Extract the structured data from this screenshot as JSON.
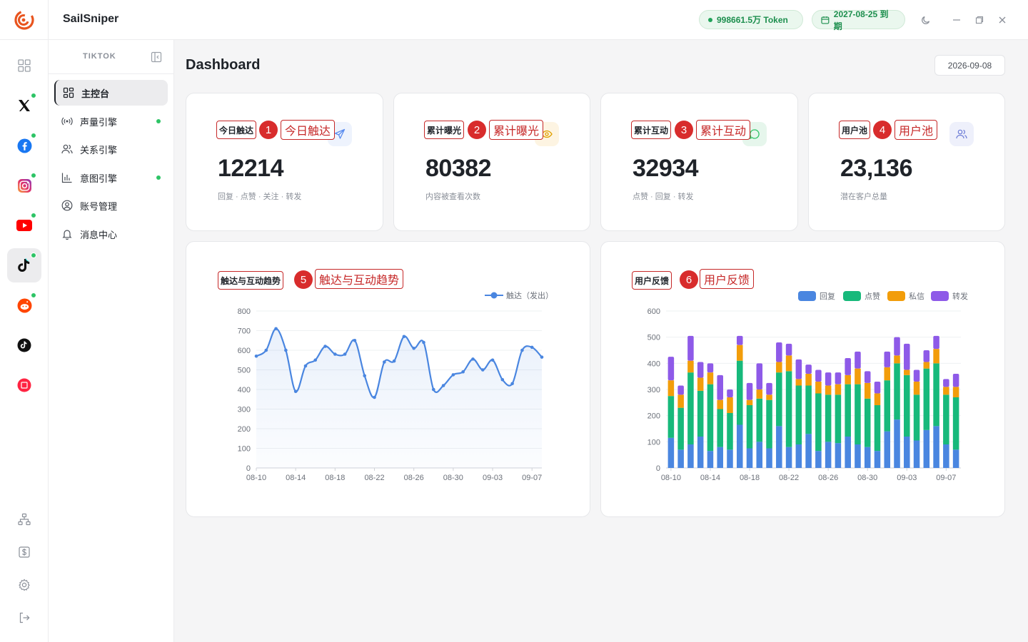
{
  "app": {
    "name": "SailSniper",
    "token_text": "998661.5万 Token",
    "expire_text": "2027-08-25 到期"
  },
  "nav": {
    "platform": "TIKTOK",
    "items": [
      {
        "label": "主控台",
        "icon": "dashboard-icon",
        "active": true,
        "dot": false
      },
      {
        "label": "声量引擎",
        "icon": "broadcast-icon",
        "active": false,
        "dot": true
      },
      {
        "label": "关系引擎",
        "icon": "users-icon",
        "active": false,
        "dot": false
      },
      {
        "label": "意图引擎",
        "icon": "bar-chart-icon",
        "active": false,
        "dot": true
      },
      {
        "label": "账号管理",
        "icon": "user-circle-icon",
        "active": false,
        "dot": false
      },
      {
        "label": "消息中心",
        "icon": "bell-icon",
        "active": false,
        "dot": false
      }
    ]
  },
  "rail": {
    "platforms": [
      {
        "name": "grid",
        "online": false
      },
      {
        "name": "x",
        "online": true
      },
      {
        "name": "facebook",
        "online": true
      },
      {
        "name": "instagram",
        "online": true
      },
      {
        "name": "youtube",
        "online": true
      },
      {
        "name": "tiktok",
        "online": true,
        "active": true
      },
      {
        "name": "reddit",
        "online": true
      },
      {
        "name": "tiktok-alt",
        "online": false
      },
      {
        "name": "xiaohongshu",
        "online": false
      }
    ],
    "bottom": [
      "org-chart-icon",
      "dollar-icon",
      "settings-icon",
      "logout-icon"
    ]
  },
  "page": {
    "title": "Dashboard",
    "date": "2026-09-08"
  },
  "stats": [
    {
      "label": "今日触达",
      "anno_num": "1",
      "anno_text": "今日触达",
      "value": "12214",
      "sub": "回复 · 点赞 · 关注 · 转发",
      "icon": "send-icon",
      "icon_color": "#5b8def",
      "icon_bg": "#eef3fd"
    },
    {
      "label": "累计曝光",
      "anno_num": "2",
      "anno_text": "累计曝光",
      "value": "80382",
      "sub": "内容被查看次数",
      "icon": "eye-icon",
      "icon_color": "#e0a000",
      "icon_bg": "#fdf4e2"
    },
    {
      "label": "累计互动",
      "anno_num": "3",
      "anno_text": "累计互动",
      "value": "32934",
      "sub": "点赞 · 回复 · 转发",
      "icon": "chat-icon",
      "icon_color": "#2ec466",
      "icon_bg": "#e6f6ec"
    },
    {
      "label": "用户池",
      "anno_num": "4",
      "anno_text": "用户池",
      "value": "23,136",
      "sub": "潜在客户总量",
      "icon": "users-icon",
      "icon_color": "#6b7bd6",
      "icon_bg": "#eef0fb"
    }
  ],
  "charts": {
    "trend": {
      "label": "触达与互动趋势",
      "anno_num": "5",
      "anno_text": "触达与互动趋势"
    },
    "feedback": {
      "label": "用户反馈",
      "anno_num": "6",
      "anno_text": "用户反馈"
    }
  },
  "chart_data": [
    {
      "type": "line",
      "title": "触达与互动趋势",
      "x_tick_labels": [
        "08-10",
        "08-14",
        "08-18",
        "08-22",
        "08-26",
        "08-30",
        "09-03",
        "09-07"
      ],
      "x": [
        "08-10",
        "08-11",
        "08-12",
        "08-13",
        "08-14",
        "08-15",
        "08-16",
        "08-17",
        "08-18",
        "08-19",
        "08-20",
        "08-21",
        "08-22",
        "08-23",
        "08-24",
        "08-25",
        "08-26",
        "08-27",
        "08-28",
        "08-29",
        "08-30",
        "08-31",
        "09-01",
        "09-02",
        "09-03",
        "09-04",
        "09-05",
        "09-06",
        "09-07",
        "09-08"
      ],
      "series": [
        {
          "name": "触达（发出）",
          "color": "#4a86e0",
          "values": [
            570,
            600,
            710,
            600,
            390,
            520,
            550,
            620,
            580,
            580,
            650,
            470,
            360,
            540,
            545,
            670,
            610,
            640,
            400,
            420,
            475,
            490,
            555,
            500,
            550,
            450,
            430,
            600,
            615,
            565
          ]
        }
      ],
      "ylim": [
        0,
        800
      ],
      "y_ticks": [
        0,
        100,
        200,
        300,
        400,
        500,
        600,
        700,
        800
      ],
      "legend": "top-right",
      "grid": true
    },
    {
      "type": "bar",
      "stacked": true,
      "title": "用户反馈",
      "x_tick_labels": [
        "08-10",
        "08-14",
        "08-18",
        "08-22",
        "08-26",
        "08-30",
        "09-03",
        "09-07"
      ],
      "x": [
        "08-10",
        "08-11",
        "08-12",
        "08-13",
        "08-14",
        "08-15",
        "08-16",
        "08-17",
        "08-18",
        "08-19",
        "08-20",
        "08-21",
        "08-22",
        "08-23",
        "08-24",
        "08-25",
        "08-26",
        "08-27",
        "08-28",
        "08-29",
        "08-30",
        "08-31",
        "09-01",
        "09-02",
        "09-03",
        "09-04",
        "09-05",
        "09-06",
        "09-07",
        "09-08"
      ],
      "series": [
        {
          "name": "回复",
          "color": "#4a86e0",
          "values": [
            115,
            70,
            90,
            120,
            65,
            80,
            70,
            165,
            75,
            100,
            75,
            160,
            80,
            90,
            130,
            65,
            100,
            95,
            120,
            90,
            80,
            65,
            140,
            185,
            120,
            105,
            145,
            160,
            90,
            70
          ]
        },
        {
          "name": "点赞",
          "color": "#17b97b",
          "values": [
            160,
            160,
            275,
            175,
            255,
            145,
            140,
            245,
            165,
            165,
            185,
            205,
            290,
            225,
            185,
            220,
            180,
            185,
            200,
            230,
            185,
            175,
            195,
            215,
            235,
            175,
            235,
            240,
            190,
            200
          ]
        },
        {
          "name": "私信",
          "color": "#f29d0a",
          "values": [
            60,
            50,
            45,
            50,
            45,
            35,
            60,
            60,
            20,
            35,
            20,
            40,
            60,
            25,
            45,
            45,
            35,
            40,
            35,
            60,
            60,
            45,
            50,
            30,
            20,
            50,
            25,
            55,
            30,
            40
          ]
        },
        {
          "name": "转发",
          "color": "#8e5ae8",
          "values": [
            90,
            35,
            95,
            60,
            35,
            95,
            30,
            35,
            65,
            100,
            45,
            75,
            45,
            75,
            35,
            45,
            50,
            45,
            65,
            65,
            45,
            45,
            60,
            70,
            100,
            45,
            45,
            50,
            30,
            50
          ]
        }
      ],
      "ylim": [
        0,
        600
      ],
      "y_ticks": [
        0,
        100,
        200,
        300,
        400,
        500,
        600
      ],
      "legend": "top-right",
      "grid": true
    }
  ]
}
